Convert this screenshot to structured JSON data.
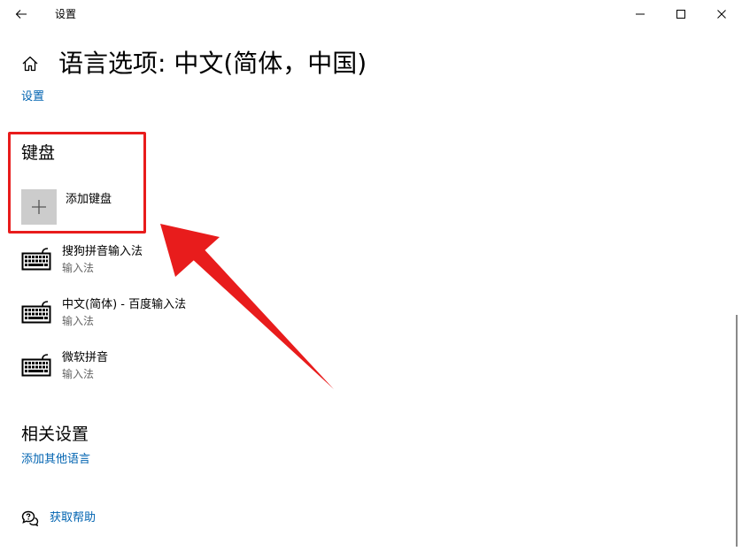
{
  "window": {
    "title": "设置",
    "back_icon": "back-arrow-icon",
    "minimize_icon": "minimize-icon",
    "maximize_icon": "maximize-icon",
    "close_icon": "close-icon"
  },
  "header": {
    "home_icon": "home-icon",
    "title": "语言选项: 中文(简体，中国)",
    "breadcrumb": "设置"
  },
  "keyboard": {
    "heading": "键盘",
    "add_label": "添加键盘",
    "add_icon": "plus-icon",
    "items": [
      {
        "name": "搜狗拼音输入法",
        "type": "输入法",
        "icon": "keyboard-icon"
      },
      {
        "name": "中文(简体) - 百度输入法",
        "type": "输入法",
        "icon": "keyboard-icon"
      },
      {
        "name": "微软拼音",
        "type": "输入法",
        "icon": "keyboard-icon"
      }
    ]
  },
  "related": {
    "heading": "相关设置",
    "link": "添加其他语言"
  },
  "help": {
    "label": "获取帮助",
    "icon": "help-chat-icon"
  },
  "colors": {
    "link": "#0063b1",
    "highlight": "#e81c1c",
    "tile": "#cccccc",
    "subtext": "#666666"
  }
}
